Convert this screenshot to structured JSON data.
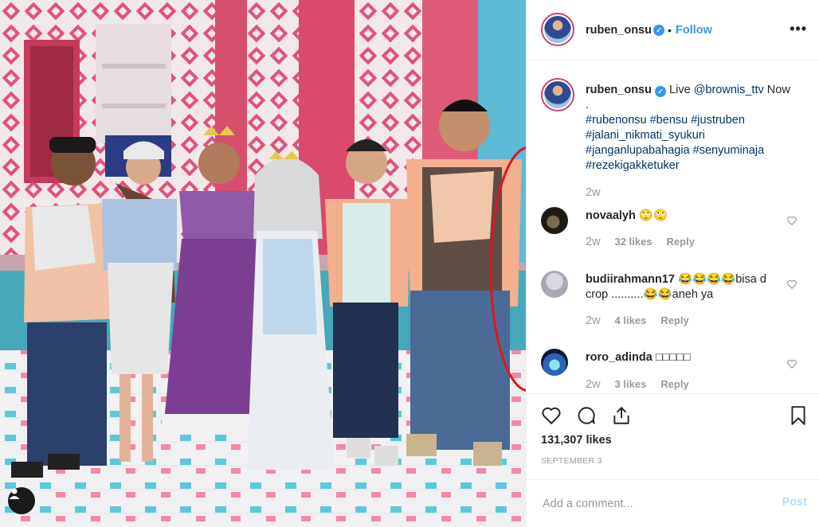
{
  "header": {
    "username": "ruben_onsu",
    "separator": "•",
    "follow_label": "Follow",
    "more_label": "•••"
  },
  "caption": {
    "username": "ruben_onsu",
    "text_prefix": "Live ",
    "mention": "@brownis_ttv",
    "text_suffix": " Now",
    "line2": ".",
    "hashtags": "#rubenonsu #bensu #justruben #jalani_nikmati_syukuri #janganlupabahagia #senyuminaja #rezekigakketuker",
    "time": "2w"
  },
  "comments": [
    {
      "username": "novaalyh",
      "text": "🙄🙄",
      "time": "2w",
      "likes": "32 likes",
      "reply": "Reply"
    },
    {
      "username": "budiirahmann17",
      "text": "😂😂😂😂bisa d crop ..........😂😂aneh ya",
      "time": "2w",
      "likes": "4 likes",
      "reply": "Reply"
    },
    {
      "username": "roro_adinda",
      "text": "□□□□□",
      "time": "2w",
      "likes": "3 likes",
      "reply": "Reply"
    }
  ],
  "actions": {
    "likes": "131,307 likes",
    "date": "SEPTEMBER 3"
  },
  "add_comment": {
    "placeholder": "Add a comment...",
    "post_label": "Post"
  },
  "colors": {
    "accent": "#3897f0",
    "annotation_circle": "#d9191f",
    "post_disabled": "#b2dffc"
  },
  "icons": [
    "heart-icon",
    "comment-icon",
    "share-icon",
    "bookmark-icon",
    "verified-badge-icon",
    "user-tag-icon"
  ]
}
